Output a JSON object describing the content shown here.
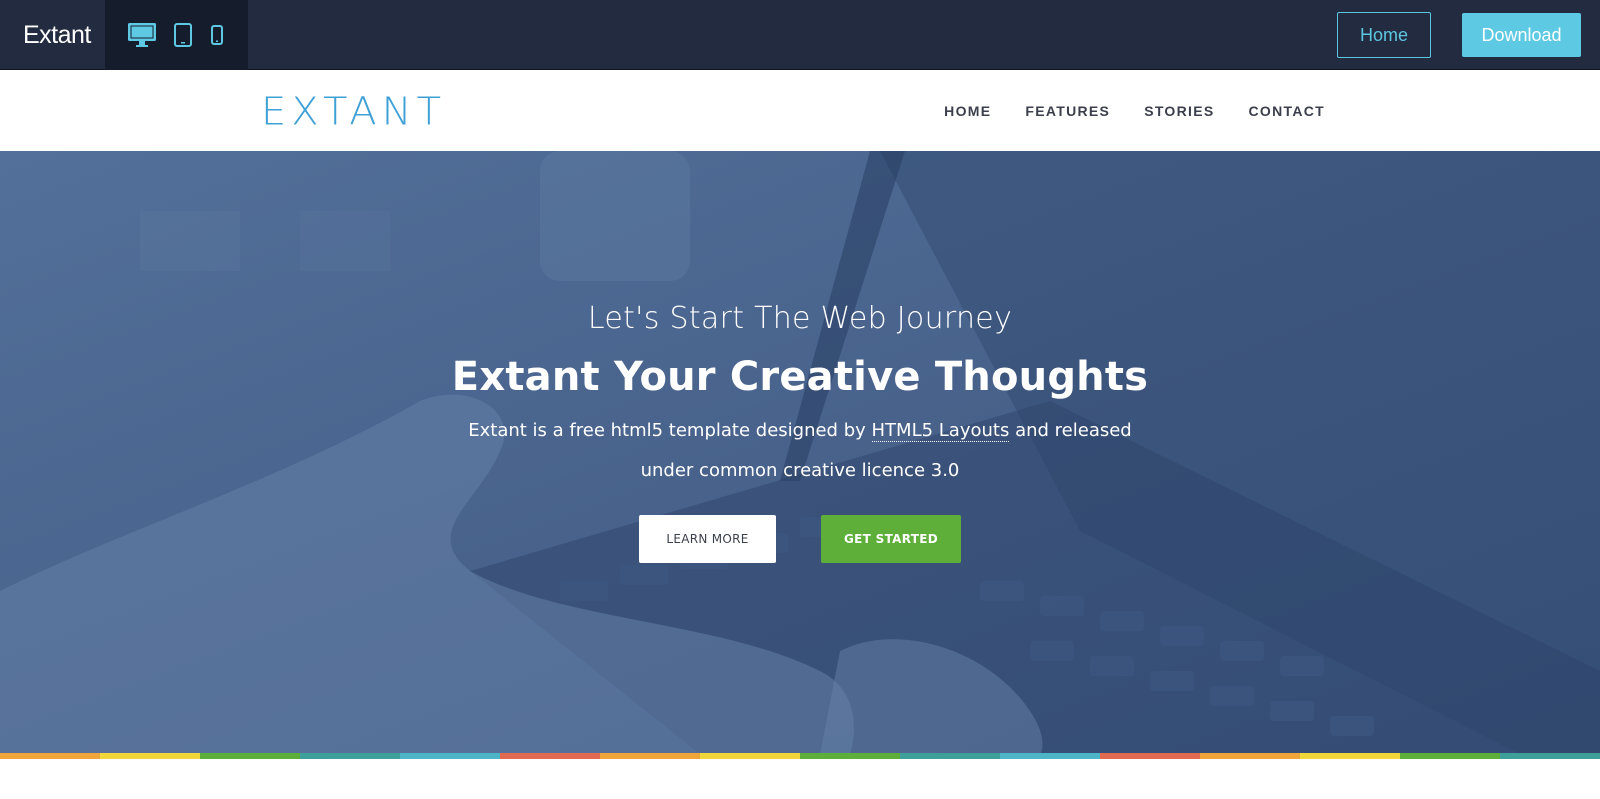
{
  "toolbar": {
    "brand": "Extant",
    "devices": [
      {
        "name": "desktop-icon",
        "active": true
      },
      {
        "name": "tablet-icon",
        "active": false
      },
      {
        "name": "phone-icon",
        "active": false
      }
    ],
    "home_label": "Home",
    "download_label": "Download"
  },
  "header": {
    "logo": "EXTANT",
    "nav": [
      "HOME",
      "FEATURES",
      "STORIES",
      "CONTACT"
    ]
  },
  "hero": {
    "subtitle": "Let's Start The Web Journey",
    "title": "Extant Your Creative Thoughts",
    "text_before": "Extant is a free html5 template designed by ",
    "text_link": "HTML5 Layouts",
    "text_after": " and released under common creative licence 3.0",
    "learn_more": "LEARN MORE",
    "get_started": "GET STARTED"
  },
  "colors": {
    "toolbar_bg": "#222b40",
    "accent": "#5ec9e3",
    "logo": "#3fa0d6",
    "hero_overlay": "#49638c",
    "get_started": "#5daf3a",
    "stripe": [
      "#f0a53a",
      "#f1d63a",
      "#5daf3a",
      "#3fa09a",
      "#4cb5c8",
      "#e06b50"
    ]
  }
}
